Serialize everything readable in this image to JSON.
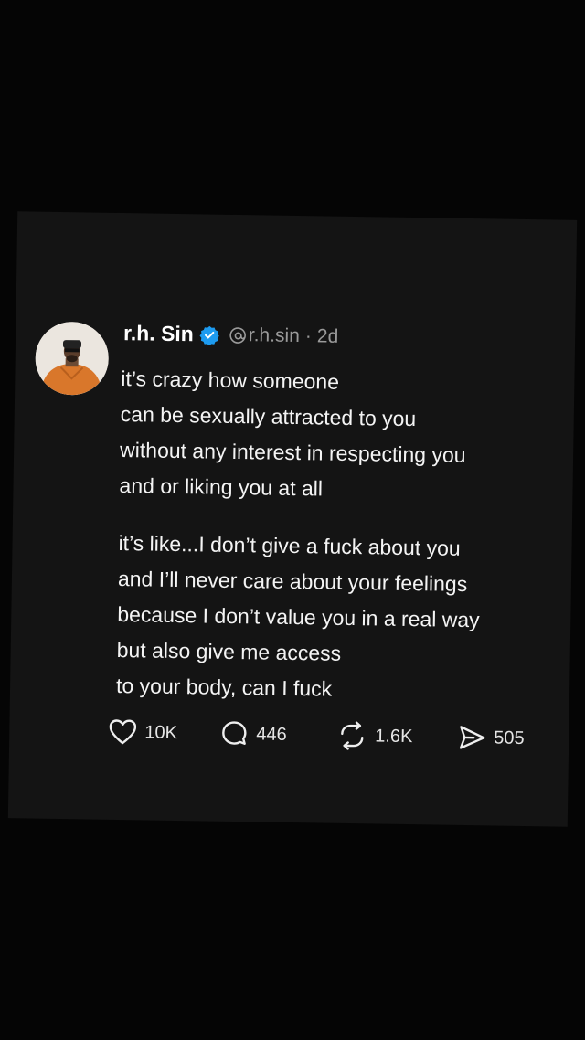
{
  "post": {
    "author_name": "r.h. Sin",
    "handle": "r.h.sin",
    "separator": "·",
    "time_ago": "2d",
    "paragraphs": [
      [
        "it’s crazy how someone",
        "can be sexually attracted to you",
        "without any interest in respecting you",
        "and or liking you at all"
      ],
      [
        "it’s like...I don’t give a fuck about you",
        "and I’ll never care about your feelings",
        "because I don’t value you in a real way",
        "but also give me access",
        "to your body, can I fuck"
      ]
    ],
    "icons": {
      "avatar": "avatar",
      "verified": "verified-badge-icon",
      "threads": "threads-icon"
    },
    "colors": {
      "background": "#050505",
      "panel": "#141414",
      "verified": "#1d9bf0",
      "avatar_shirt": "#d9772b"
    }
  },
  "actions": {
    "likes": "10K",
    "replies": "446",
    "reposts": "1.6K",
    "shares": "505",
    "icons": [
      "heart-icon",
      "comment-icon",
      "repost-icon",
      "share-icon"
    ]
  }
}
